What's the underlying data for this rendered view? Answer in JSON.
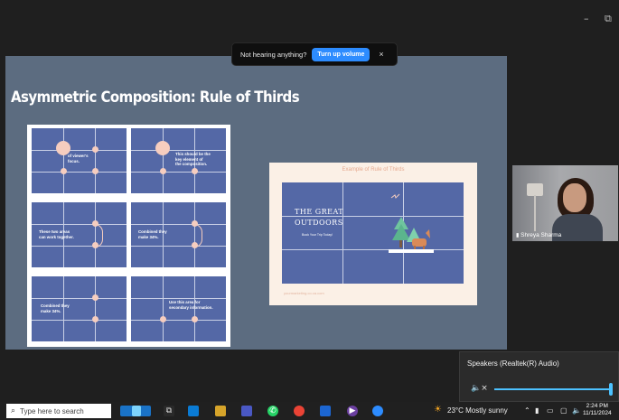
{
  "window": {
    "minimize_glyph": "–",
    "restore_glyph": "⧉"
  },
  "banner": {
    "message": "Not hearing anything?",
    "button": "Turn up volume",
    "close": "×"
  },
  "slide": {
    "title": "Asymmetric Composition: Rule of Thirds",
    "panels": [
      {
        "text": "of viewer's\nfocus."
      },
      {
        "text": "This should be the\nkey element of\nthe composition."
      },
      {
        "text": "These two areas\ncan work together."
      },
      {
        "text": "Combined they\nmake 34%."
      },
      {
        "text": "Combined they\nmake 34%."
      },
      {
        "text": "Use this area for\nsecondary information."
      }
    ],
    "example": {
      "caption": "Example of Rule of Thirds",
      "headline1": "THE GREAT",
      "headline2": "OUTDOORS",
      "subline": "Book Your Trip Today!",
      "footer": "yourmarketing.co.ca.com"
    }
  },
  "participant": {
    "name": "Shreya Sharma",
    "mic_icon": "bar-signal-icon"
  },
  "speakers": {
    "label": "Speakers (Realtek(R) Audio)",
    "mute_glyph": "🔈×",
    "volume_fraction": 0.97
  },
  "taskbar": {
    "search_placeholder": "Type here to search",
    "weather": "23°C  Mostly sunny",
    "time": "2:24 PM",
    "date": "11/11/2024"
  },
  "colors": {
    "slide_bg": "#5c6c80",
    "panel": "#5468a6",
    "accent": "#2d8cff",
    "peach": "#f6cdbf"
  }
}
